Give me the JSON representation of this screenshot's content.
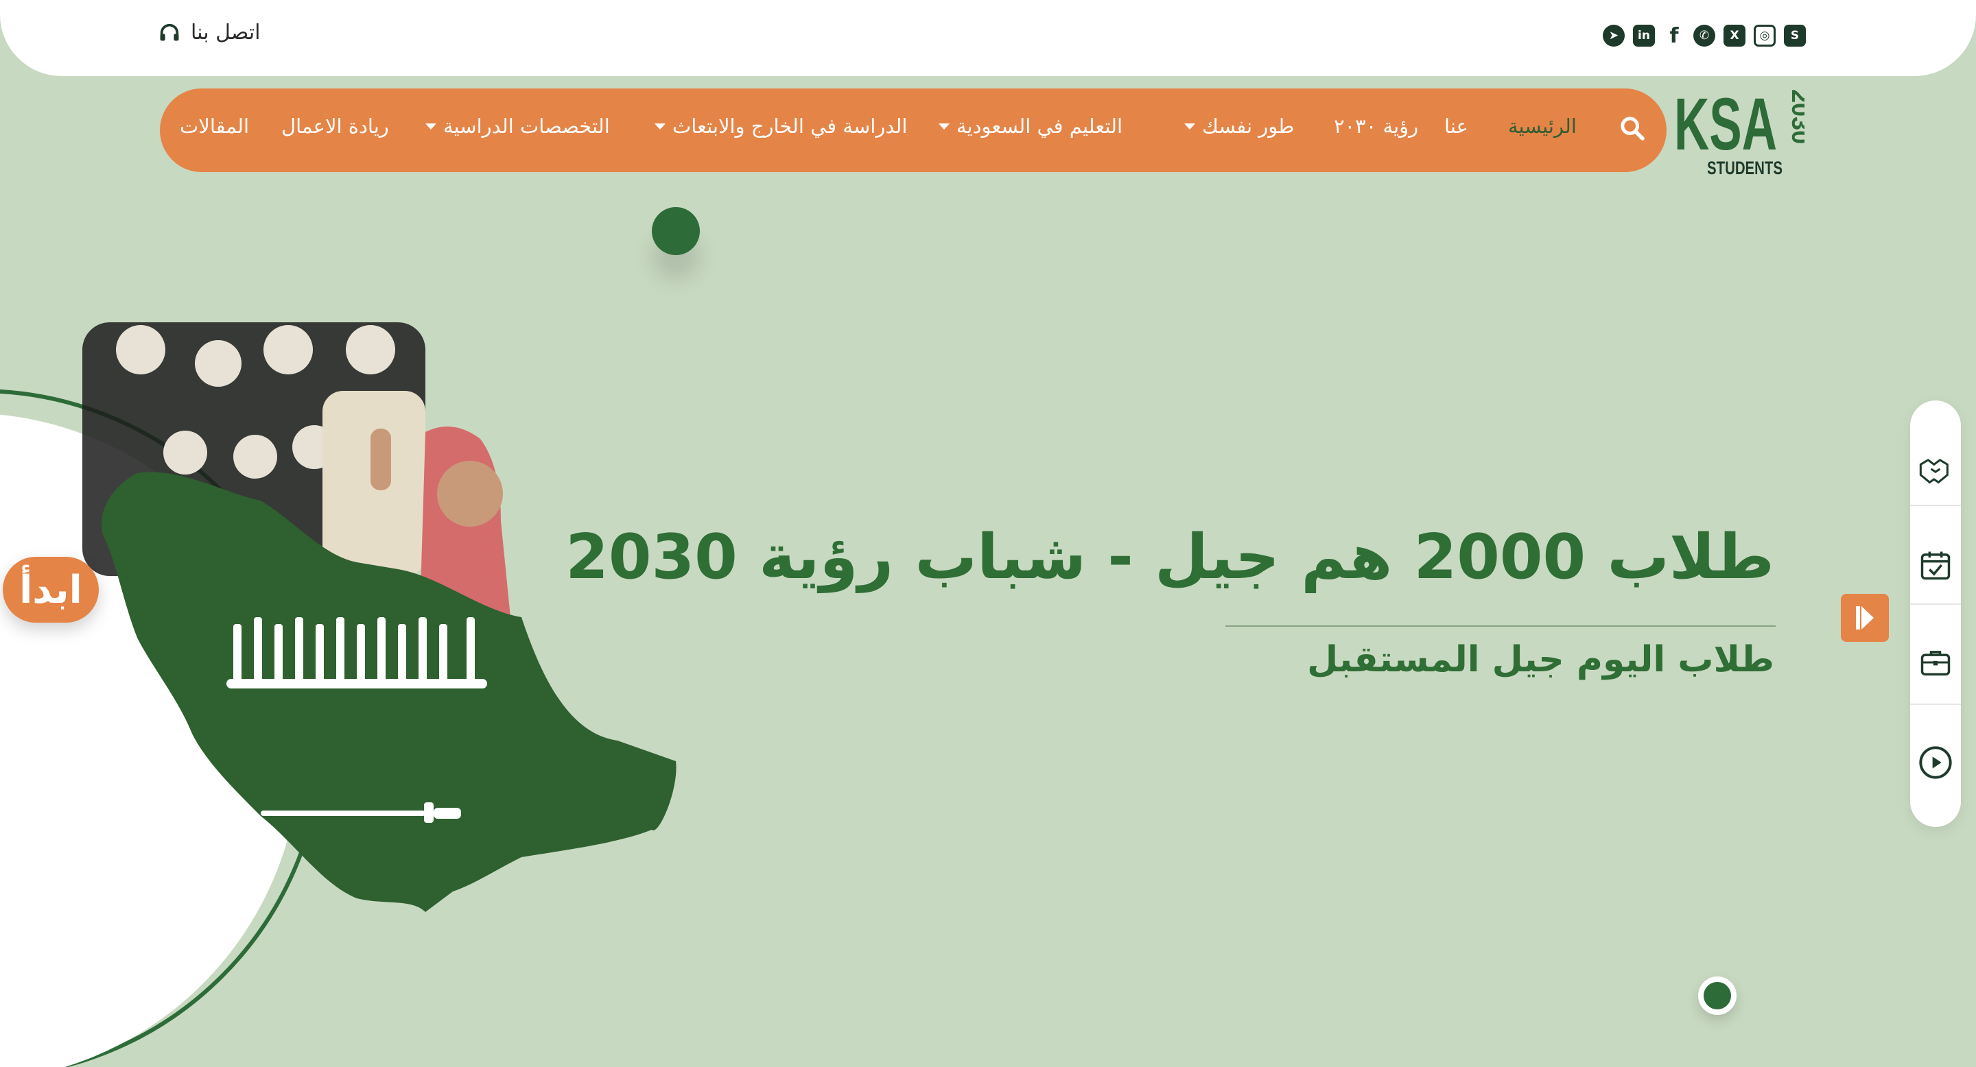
{
  "topbar": {
    "contact_label": "اتصل بنا",
    "social": [
      {
        "icon": "snapchat-icon",
        "glyph": "S"
      },
      {
        "icon": "instagram-icon",
        "glyph": "◎"
      },
      {
        "icon": "x-twitter-icon",
        "glyph": "X"
      },
      {
        "icon": "whatsapp-icon",
        "glyph": "✆"
      },
      {
        "icon": "facebook-icon",
        "glyph": "f"
      },
      {
        "icon": "linkedin-icon",
        "glyph": "in"
      },
      {
        "icon": "telegram-icon",
        "glyph": "➤"
      }
    ]
  },
  "logo": {
    "main": "KSA",
    "year": "2030",
    "sub": "STUDENTS"
  },
  "nav": {
    "items": [
      {
        "label": "الرئيسية",
        "active": true,
        "dropdown": false
      },
      {
        "label": "عنا",
        "active": false,
        "dropdown": false
      },
      {
        "label": "رؤية ٢٠٣٠",
        "active": false,
        "dropdown": false
      },
      {
        "label": "طور نفسك",
        "active": false,
        "dropdown": true
      },
      {
        "label": "التعليم في السعودية",
        "active": false,
        "dropdown": true
      },
      {
        "label": "الدراسة في الخارج والابتعاث",
        "active": false,
        "dropdown": true
      },
      {
        "label": "التخصصات الدراسية",
        "active": false,
        "dropdown": true
      },
      {
        "label": "ريادة الاعمال",
        "active": false,
        "dropdown": false
      },
      {
        "label": "المقالات",
        "active": false,
        "dropdown": false
      }
    ]
  },
  "hero": {
    "title": "طلاب 2000 هم جيل - شباب رؤية 2030",
    "subtitle": "طلاب اليوم جيل المستقبل",
    "start_button": "ابدأ"
  },
  "colors": {
    "background": "#c8d9c1",
    "accent_orange": "#e58447",
    "brand_green": "#2f6e35",
    "white": "#ffffff"
  },
  "side_panel": {
    "icons": [
      "handshake-icon",
      "calendar-check-icon",
      "briefcase-icon",
      "play-circle-icon"
    ]
  }
}
